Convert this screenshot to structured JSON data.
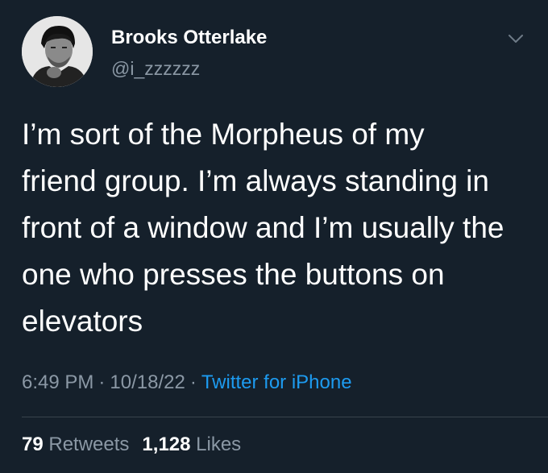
{
  "author": {
    "name": "Brooks Otterlake",
    "handle": "@i_zzzzzz"
  },
  "tweet": {
    "lines": [
      "I’m sort of the Morpheus of my",
      "friend group. I’m always standing in",
      "front of a window and I’m usually the",
      "one who presses the buttons on",
      "elevators"
    ]
  },
  "meta": {
    "time": "6:49 PM",
    "date": "10/18/22",
    "separator": "·",
    "source": "Twitter for iPhone"
  },
  "stats": {
    "retweets_count": "79",
    "retweets_label": "Retweets",
    "likes_count": "1,128",
    "likes_label": "Likes"
  },
  "icons": {
    "more": "chevron-down-icon"
  },
  "colors": {
    "background": "#15202b",
    "text": "#ffffff",
    "secondary": "#8b98a5",
    "link": "#1d9bf0",
    "divider": "#38444d"
  }
}
